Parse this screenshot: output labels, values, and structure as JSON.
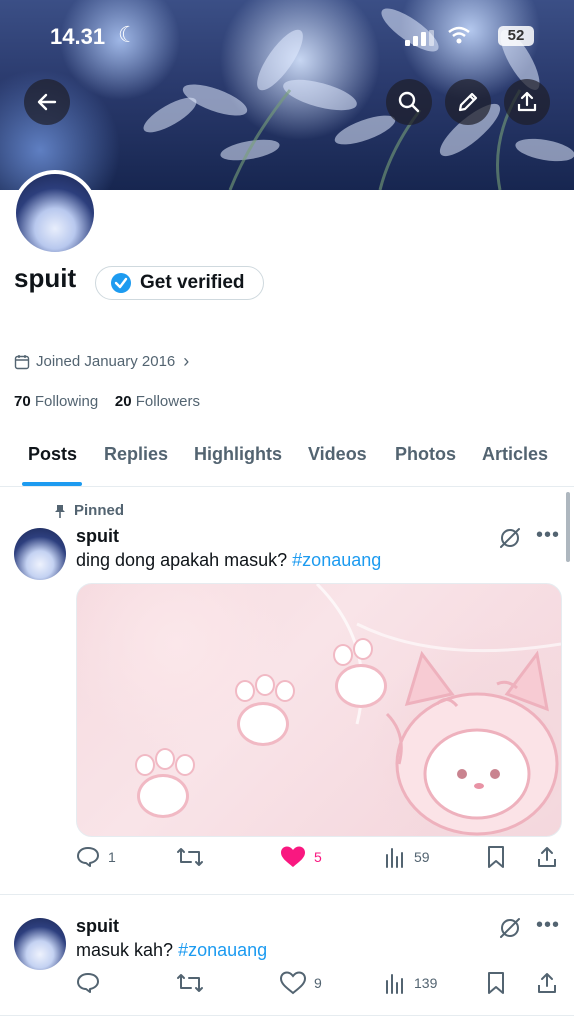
{
  "status": {
    "time": "14.31",
    "battery": "52"
  },
  "profile": {
    "name": "spuit",
    "verify_label": "Get verified",
    "joined": "Joined January 2016",
    "following_count": "70",
    "following_label": "Following",
    "followers_count": "20",
    "followers_label": "Followers"
  },
  "tabs": [
    {
      "label": "Posts"
    },
    {
      "label": "Replies"
    },
    {
      "label": "Highlights"
    },
    {
      "label": "Videos"
    },
    {
      "label": "Photos"
    },
    {
      "label": "Articles"
    }
  ],
  "posts": [
    {
      "pinned_label": "Pinned",
      "author": "spuit",
      "text": "ding dong apakah masuk? ",
      "hashtag": "#zonauang",
      "replies": "1",
      "likes": "5",
      "views": "59",
      "liked": true
    },
    {
      "author": "spuit",
      "text": "masuk kah? ",
      "hashtag": "#zonauang",
      "replies": "",
      "likes": "9",
      "views": "139",
      "liked": false
    }
  ],
  "colors": {
    "accent": "#1d9bf0",
    "like": "#f91880",
    "muted": "#536471"
  }
}
